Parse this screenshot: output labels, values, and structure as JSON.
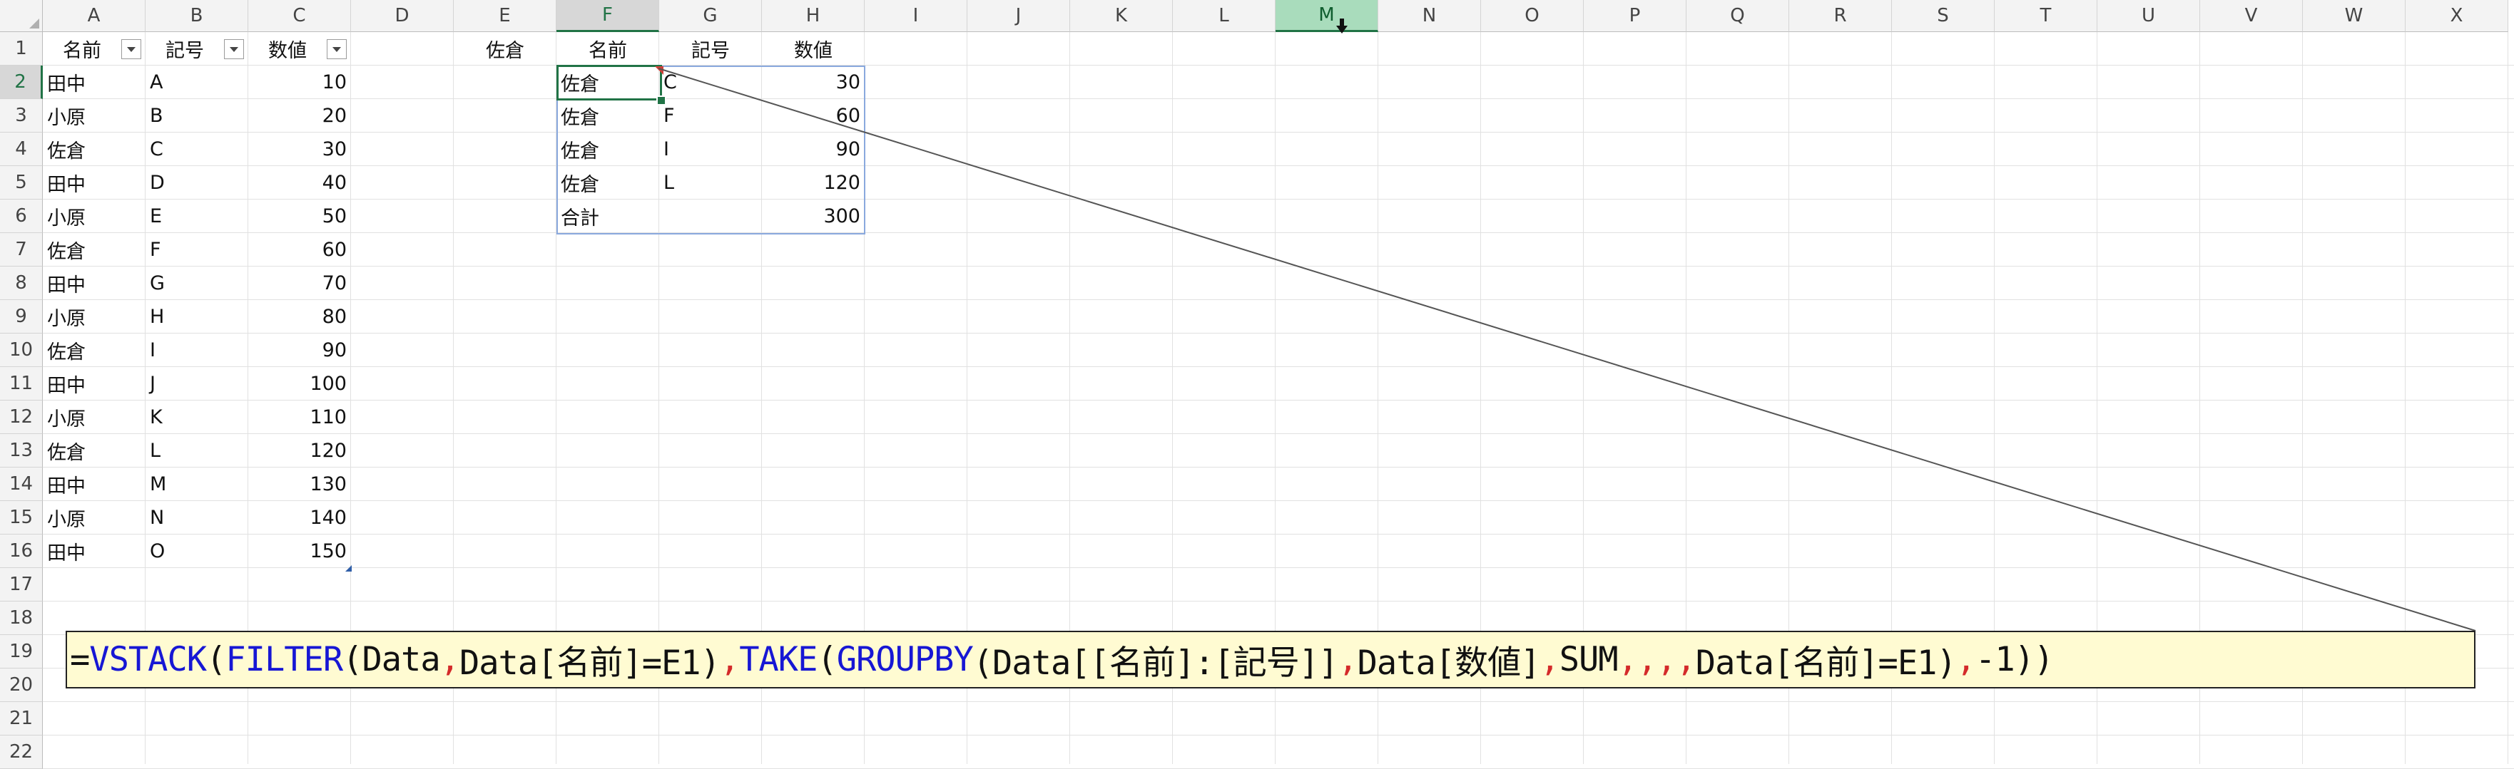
{
  "columns": [
    "A",
    "B",
    "C",
    "D",
    "E",
    "F",
    "G",
    "H",
    "I",
    "J",
    "K",
    "L",
    "M",
    "N",
    "O",
    "P",
    "Q",
    "R",
    "S",
    "T",
    "U",
    "V",
    "W",
    "X"
  ],
  "rows": [
    "1",
    "2",
    "3",
    "4",
    "5",
    "6",
    "7",
    "8",
    "9",
    "10",
    "11",
    "12",
    "13",
    "14",
    "15",
    "16",
    "17",
    "18",
    "19",
    "20",
    "21",
    "22"
  ],
  "table": {
    "headers": [
      "名前",
      "記号",
      "数値"
    ],
    "rows": [
      [
        "田中",
        "A",
        "10"
      ],
      [
        "小原",
        "B",
        "20"
      ],
      [
        "佐倉",
        "C",
        "30"
      ],
      [
        "田中",
        "D",
        "40"
      ],
      [
        "小原",
        "E",
        "50"
      ],
      [
        "佐倉",
        "F",
        "60"
      ],
      [
        "田中",
        "G",
        "70"
      ],
      [
        "小原",
        "H",
        "80"
      ],
      [
        "佐倉",
        "I",
        "90"
      ],
      [
        "田中",
        "J",
        "100"
      ],
      [
        "小原",
        "K",
        "110"
      ],
      [
        "佐倉",
        "L",
        "120"
      ],
      [
        "田中",
        "M",
        "130"
      ],
      [
        "小原",
        "N",
        "140"
      ],
      [
        "田中",
        "O",
        "150"
      ]
    ]
  },
  "criteria": {
    "value": "佐倉"
  },
  "result": {
    "headers": [
      "名前",
      "記号",
      "数値"
    ],
    "rows": [
      [
        "佐倉",
        "C",
        "30"
      ],
      [
        "佐倉",
        "F",
        "60"
      ],
      [
        "佐倉",
        "I",
        "90"
      ],
      [
        "佐倉",
        "L",
        "120"
      ],
      [
        "合計",
        "",
        "300"
      ]
    ]
  },
  "formula": {
    "segments": [
      {
        "text": "=",
        "kind": "tx"
      },
      {
        "text": "VSTACK",
        "kind": "fn"
      },
      {
        "text": "(",
        "kind": "tx"
      },
      {
        "text": "FILTER",
        "kind": "fn"
      },
      {
        "text": "(Data",
        "kind": "tx"
      },
      {
        "text": ",",
        "kind": "ctl"
      },
      {
        "text": "Data[名前]=E1)",
        "kind": "tx"
      },
      {
        "text": ",",
        "kind": "ctl"
      },
      {
        "text": "TAKE",
        "kind": "fn"
      },
      {
        "text": "(",
        "kind": "tx"
      },
      {
        "text": "GROUPBY",
        "kind": "fn"
      },
      {
        "text": "(Data[[名前]:[記号]]",
        "kind": "tx"
      },
      {
        "text": ",",
        "kind": "ctl"
      },
      {
        "text": "Data[数値]",
        "kind": "tx"
      },
      {
        "text": ",",
        "kind": "ctl"
      },
      {
        "text": "SUM",
        "kind": "tx"
      },
      {
        "text": ",,,",
        "kind": "ctl"
      },
      {
        "text": ",",
        "kind": "ctl"
      },
      {
        "text": "Data[名前]=E1)",
        "kind": "tx"
      },
      {
        "text": ",",
        "kind": "ctl"
      },
      {
        "text": "-1))",
        "kind": "tx"
      }
    ]
  },
  "selection": {
    "active_cell": "F2",
    "selected_column": "M"
  },
  "colors": {
    "accent": "#217346",
    "function": "#1717d4",
    "separator": "#d42a2a",
    "spill_border": "#8aa9de",
    "formula_bg": "#fffbd2"
  }
}
